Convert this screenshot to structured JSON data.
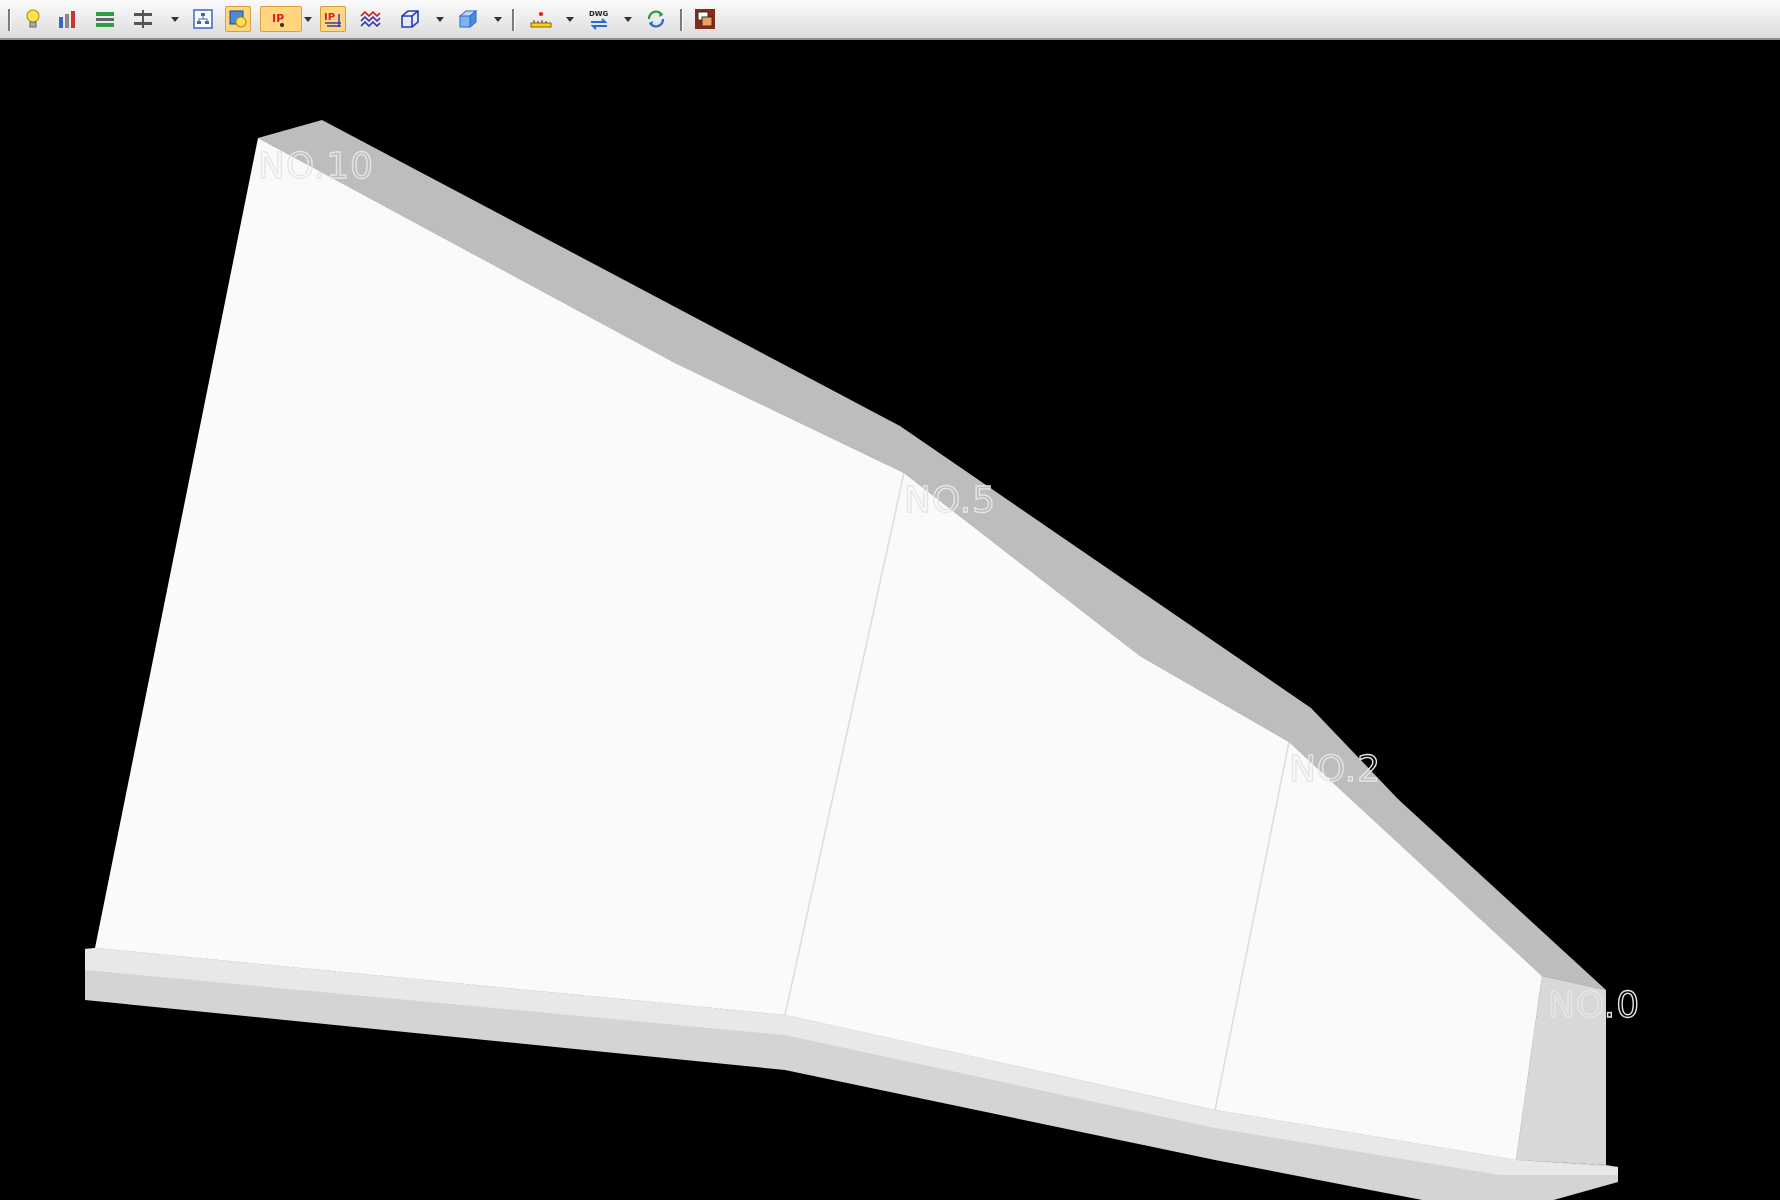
{
  "toolbar": {
    "buttons": [
      {
        "icon": "lightbulb-icon"
      },
      {
        "icon": "tools-icon"
      },
      {
        "icon": "align-horizontal-icon"
      },
      {
        "icon": "split-horizontal-icon"
      },
      {
        "icon": "structure-tree-icon"
      },
      {
        "icon": "display-settings-icon"
      },
      {
        "icon": "ip-point-icon"
      },
      {
        "icon": "ip-layers-icon"
      },
      {
        "icon": "wave-icon"
      },
      {
        "icon": "cube-outline-icon"
      },
      {
        "icon": "cube-shaded-icon"
      },
      {
        "icon": "ruler-icon"
      },
      {
        "icon": "dwg-export-icon"
      },
      {
        "icon": "refresh-swap-icon"
      },
      {
        "icon": "cascade-windows-icon"
      }
    ],
    "dwg_label": "DWG",
    "ip_label": "IP"
  },
  "viewport": {
    "background": "#000000",
    "face_color": "#fafafa",
    "top_color": "#bdbdbd",
    "labels": {
      "no10": "NO.10",
      "no5": "NO.5",
      "no2": "NO.2",
      "no0": "NO.0"
    }
  }
}
